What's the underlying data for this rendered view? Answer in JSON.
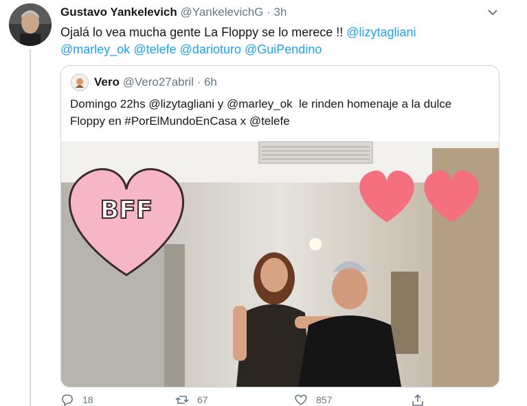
{
  "tweet": {
    "author_name": "Gustavo Yankelevich",
    "handle": "@YankelevichG",
    "time": "3h",
    "text_before": "Ojalá lo vea mucha gente La Floppy se lo merece !! ",
    "mentions": [
      "@lizytagliani",
      "@marley_ok",
      "@telefe",
      "@darioturo",
      "@GuiPendino"
    ],
    "actions": {
      "reply_count": "18",
      "retweet_count": "67",
      "like_count": "857"
    }
  },
  "quoted": {
    "author_name": "Vero",
    "handle": "@Vero27abril",
    "time": "6h",
    "line1_a": "Domingo 22hs ",
    "line1_m1": "@lizytagliani",
    "line1_b": " y ",
    "line1_m2": "@marley_ok",
    "line1_c": "  le rinden homenaje a la dulce",
    "line2_a": "Floppy en ",
    "line2_hashtag": "#PorElMundoEnCasa",
    "line2_b": " x ",
    "line2_m3": "@telefe",
    "sticker_text": "BFF"
  },
  "icons": [
    "chevron-down-icon",
    "reply-icon",
    "retweet-icon",
    "like-icon",
    "share-icon"
  ],
  "colors": {
    "link": "#1da1f2",
    "muted": "#657786",
    "border": "#ccd6dd",
    "heart": "#f4707e"
  }
}
